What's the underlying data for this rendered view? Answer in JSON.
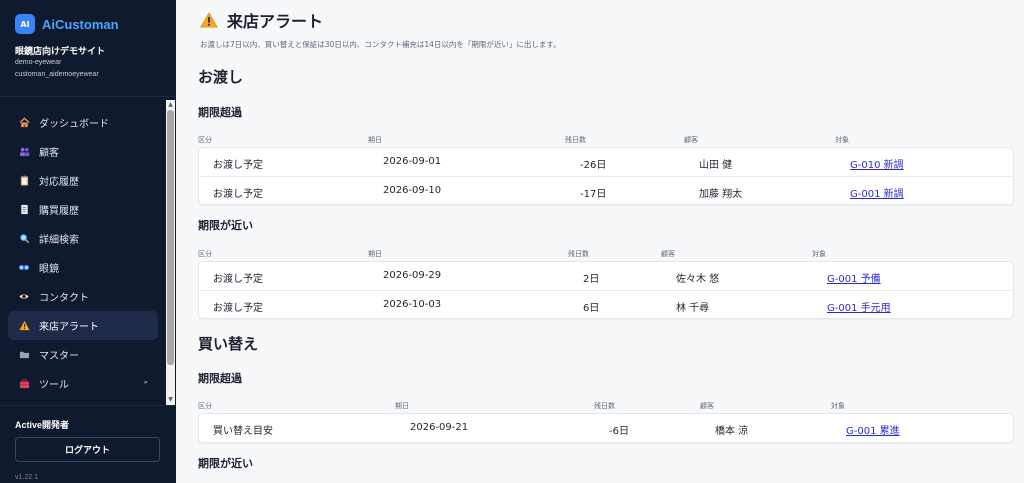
{
  "brand": {
    "logo": "AI",
    "name": "AiCustoman"
  },
  "site": {
    "name": "眼鏡店向けデモサイト",
    "id": "demo-eyewear",
    "account": "customan_aidemoeyewear"
  },
  "nav": [
    {
      "label": "ダッシュボード",
      "icon": "house-icon"
    },
    {
      "label": "顧客",
      "icon": "people-icon"
    },
    {
      "label": "対応履歴",
      "icon": "clipboard-icon"
    },
    {
      "label": "購買履歴",
      "icon": "receipt-icon"
    },
    {
      "label": "詳細検索",
      "icon": "magnifier-icon"
    },
    {
      "label": "眼鏡",
      "icon": "glasses-icon"
    },
    {
      "label": "コンタクト",
      "icon": "eye-icon"
    },
    {
      "label": "来店アラート",
      "icon": "warning-icon",
      "active": true
    },
    {
      "label": "マスター",
      "icon": "folder-icon"
    },
    {
      "label": "ツール",
      "icon": "toolbox-icon",
      "caret": "▸"
    }
  ],
  "user": {
    "label": "Active開発者",
    "logout": "ログアウト",
    "version": "v1.22.1"
  },
  "page": {
    "title": "来店アラート",
    "description": "お渡しは7日以内、買い替えと保証は30日以内、コンタクト補充は14日以内を「期限が近い」に出します。"
  },
  "sections": {
    "handover": {
      "title": "お渡し",
      "overdue": {
        "title": "期限超過",
        "headers": [
          "区分",
          "期日",
          "残日数",
          "顧客",
          "対象"
        ],
        "rows": [
          [
            "お渡し予定",
            "2026-09-01",
            "-26日",
            "山田 健",
            "G-010 新調"
          ],
          [
            "お渡し予定",
            "2026-09-10",
            "-17日",
            "加藤 翔太",
            "G-001 新調"
          ]
        ]
      },
      "upcoming": {
        "title": "期限が近い",
        "headers": [
          "区分",
          "期日",
          "残日数",
          "顧客",
          "対象"
        ],
        "rows": [
          [
            "お渡し予定",
            "2026-09-29",
            "2日",
            "佐々木 悠",
            "G-001 予備"
          ],
          [
            "お渡し予定",
            "2026-10-03",
            "6日",
            "林 千尋",
            "G-001 手元用"
          ]
        ]
      }
    },
    "replacement": {
      "title": "買い替え",
      "overdue": {
        "title": "期限超過",
        "headers": [
          "区分",
          "期日",
          "残日数",
          "顧客",
          "対象"
        ],
        "rows": [
          [
            "買い替え目安",
            "2026-09-21",
            "-6日",
            "橋本 涼",
            "G-001 累進"
          ]
        ]
      },
      "upcoming": {
        "title": "期限が近い"
      }
    }
  },
  "colors": {
    "sidebar": "#101a2e",
    "accent": "#4ea3ff",
    "link": "#2b2bd6",
    "warning": "#f5a623"
  }
}
